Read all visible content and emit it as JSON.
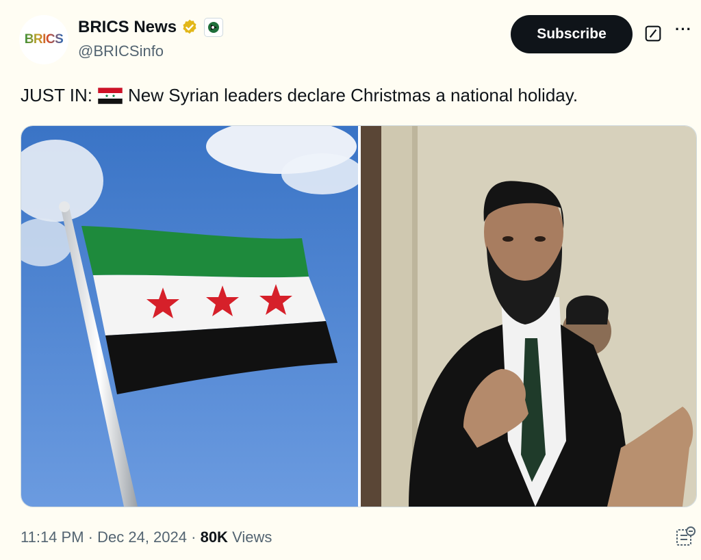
{
  "account": {
    "avatar_text": "BRICS",
    "display_name": "BRICS News",
    "handle": "@BRICSinfo"
  },
  "actions": {
    "subscribe_label": "Subscribe"
  },
  "tweet": {
    "text_before_flag": "JUST IN:",
    "text_after_flag": "New Syrian leaders declare Christmas a national holiday."
  },
  "meta": {
    "time": "11:14 PM",
    "separator": "·",
    "date": "Dec 24, 2024",
    "views_count": "80K",
    "views_label": "Views"
  },
  "icons": {
    "verified": "verified-gold-badge-icon",
    "affiliation": "affiliation-badge-icon",
    "grok": "grok-icon",
    "more": "more-horizontal-icon",
    "flag": "syria-flag-emoji-icon",
    "bookmark": "view-post-analytics-icon"
  },
  "colors": {
    "background": "#fffdf3",
    "subscribe_bg": "#0f1419",
    "verified_gold": "#e2b719",
    "muted_text": "#536471"
  }
}
